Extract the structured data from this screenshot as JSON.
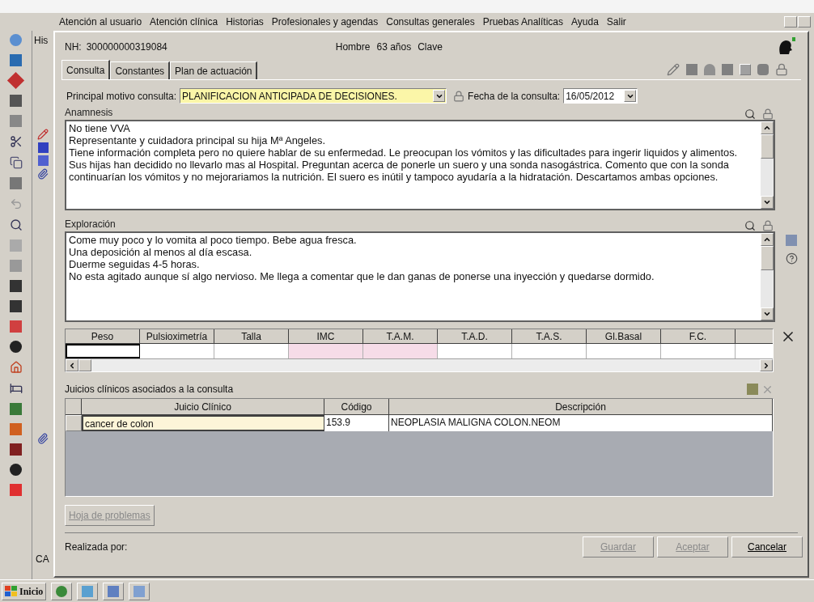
{
  "menu": [
    "Atención al usuario",
    "Atención clínica",
    "Historias",
    "Profesionales y agendas",
    "Consultas generales",
    "Pruebas Analíticas",
    "Ayuda",
    "Salir"
  ],
  "background_window": {
    "tab": "His",
    "footer": "CA"
  },
  "patient": {
    "nh_label": "NH:",
    "nh": "300000000319084",
    "sex": "Hombre",
    "age": "63 años",
    "key": "Clave"
  },
  "tabs": [
    {
      "label": "Consulta",
      "selected": true
    },
    {
      "label": "Constantes",
      "selected": false
    },
    {
      "label": "Plan de actuación",
      "selected": false
    }
  ],
  "motivo": {
    "label": "Principal motivo consulta:",
    "value": "PLANIFICACION ANTICIPADA DE DECISIONES."
  },
  "fecha": {
    "label": "Fecha de la consulta:",
    "value": "16/05/2012"
  },
  "anamnesis": {
    "label": "Anamnesis",
    "lines": [
      "No tiene VVA",
      "Representante y cuidadora principal su hija Mª Angeles.",
      "Tiene información completa pero no quiere hablar de su enfermedad. Le preocupan los vómitos y las dificultades para ingerir liquidos y alimentos.",
      "Sus hijas han decidido no llevarlo mas al Hospital. Preguntan acerca de ponerle un suero y una sonda nasogástrica. Comento que con la sonda continuarían los vómitos y no mejorariamos la nutrición. El suero es inútil y tampoco ayudaría a la hidratación. Descartamos ambas opciones."
    ]
  },
  "exploracion": {
    "label": "Exploración",
    "lines": [
      "Come muy poco y lo vomita al poco tiempo. Bebe agua fresca.",
      "Una deposición al menos al día escasa.",
      "Duerme seguidas 4-5 horas.",
      "No esta agitado aunque sí algo nervioso. Me llega a comentar que le dan ganas de ponerse una inyección y quedarse dormido."
    ]
  },
  "constants": [
    {
      "label": "Peso",
      "readonly": false,
      "selected": true
    },
    {
      "label": "Pulsioximetría",
      "readonly": false,
      "selected": false
    },
    {
      "label": "Talla",
      "readonly": false,
      "selected": false
    },
    {
      "label": "IMC",
      "readonly": true,
      "selected": false
    },
    {
      "label": "T.A.M.",
      "readonly": true,
      "selected": false
    },
    {
      "label": "T.A.D.",
      "readonly": false,
      "selected": false
    },
    {
      "label": "T.A.S.",
      "readonly": false,
      "selected": false
    },
    {
      "label": "Gl.Basal",
      "readonly": false,
      "selected": false
    },
    {
      "label": "F.C.",
      "readonly": false,
      "selected": false
    }
  ],
  "juicios": {
    "label": "Juicios clínicos asociados a la consulta",
    "columns": [
      "Juicio Clínico",
      "Código",
      "Descripción"
    ],
    "rows": [
      {
        "cells": [
          "cancer de colon",
          "153.9",
          "NEOPLASIA MALIGNA COLON.NEOM"
        ],
        "selected": true
      }
    ]
  },
  "hoja_button": {
    "label": "Hoja de problemas",
    "disabled": true
  },
  "footer": {
    "label": "Realizada por:",
    "buttons": [
      {
        "label": "Guardar",
        "disabled": true
      },
      {
        "label": "Aceptar",
        "disabled": true
      },
      {
        "label": "Cancelar",
        "disabled": false
      }
    ]
  },
  "taskbar": {
    "start": "Inicio"
  }
}
